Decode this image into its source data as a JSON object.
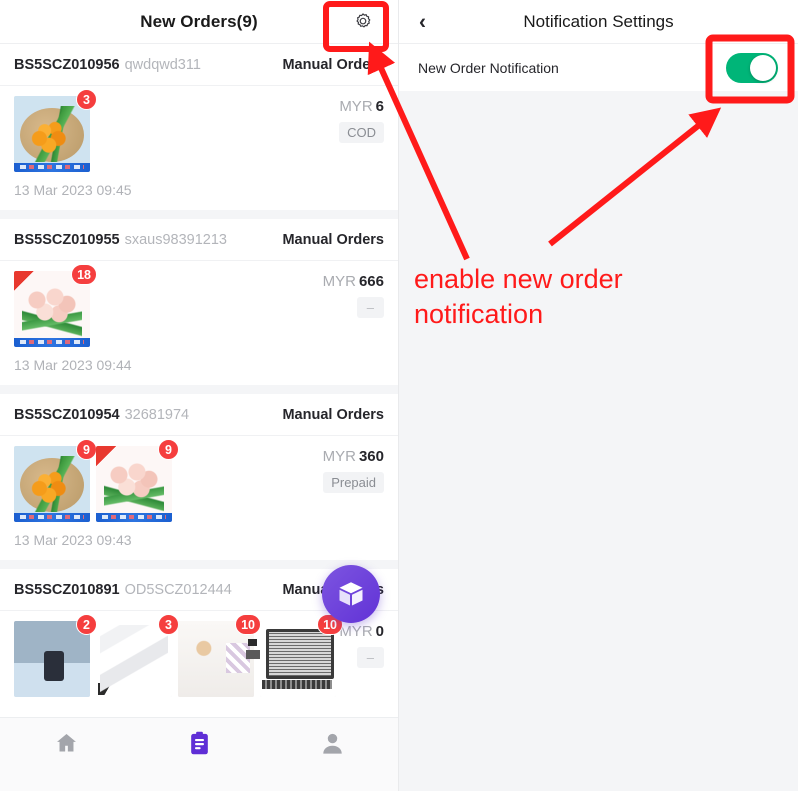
{
  "left_panel": {
    "header": {
      "title": "New Orders(9)",
      "settings_icon": "gear-icon"
    },
    "orders": [
      {
        "order_no": "BS5SCZ010956",
        "reference": "qwdqwd311",
        "type": "Manual Orders",
        "currency": "MYR",
        "amount": "6",
        "payment": "COD",
        "date": "13 Mar 2023 09:45",
        "items": [
          {
            "art": "tulip-orange",
            "qty": "3"
          }
        ]
      },
      {
        "order_no": "BS5SCZ010955",
        "reference": "sxaus98391213",
        "type": "Manual Orders",
        "currency": "MYR",
        "amount": "666",
        "payment": "–",
        "date": "13 Mar 2023 09:44",
        "items": [
          {
            "art": "tulip-pink",
            "qty": "18"
          }
        ]
      },
      {
        "order_no": "BS5SCZ010954",
        "reference": "32681974",
        "type": "Manual Orders",
        "currency": "MYR",
        "amount": "360",
        "payment": "Prepaid",
        "date": "13 Mar 2023 09:43",
        "items": [
          {
            "art": "tulip-orange",
            "qty": "9"
          },
          {
            "art": "tulip-pink",
            "qty": "9"
          }
        ]
      },
      {
        "order_no": "BS5SCZ010891",
        "reference": "OD5SCZ012444",
        "type": "Manual Orders",
        "currency": "MYR",
        "amount": "0",
        "payment": "–",
        "date": "",
        "items": [
          {
            "art": "art-device",
            "qty": "2"
          },
          {
            "art": "art-bottles",
            "qty": "3"
          },
          {
            "art": "art-room",
            "qty": "10"
          },
          {
            "art": "art-laptop",
            "qty": "10"
          }
        ]
      }
    ],
    "fab": {
      "icon": "package-box-icon"
    },
    "bottom_nav": [
      {
        "icon": "home-icon",
        "active": false
      },
      {
        "icon": "orders-clipboard-icon",
        "active": true
      },
      {
        "icon": "profile-person-icon",
        "active": false
      }
    ]
  },
  "right_panel": {
    "header": {
      "back_icon": "chevron-left-icon",
      "title": "Notification Settings"
    },
    "settings": [
      {
        "label": "New Order Notification",
        "toggle_state": "on"
      }
    ]
  },
  "annotations": {
    "callout_text": "enable new order notification",
    "color": "#ff1a1a",
    "highlight_boxes": [
      {
        "target": "settings-gear-button"
      },
      {
        "target": "new-order-notification-toggle"
      }
    ],
    "arrows": [
      {
        "from": "callout-text",
        "to": "settings-gear-button"
      },
      {
        "from": "callout-text",
        "to": "new-order-notification-toggle"
      }
    ]
  }
}
